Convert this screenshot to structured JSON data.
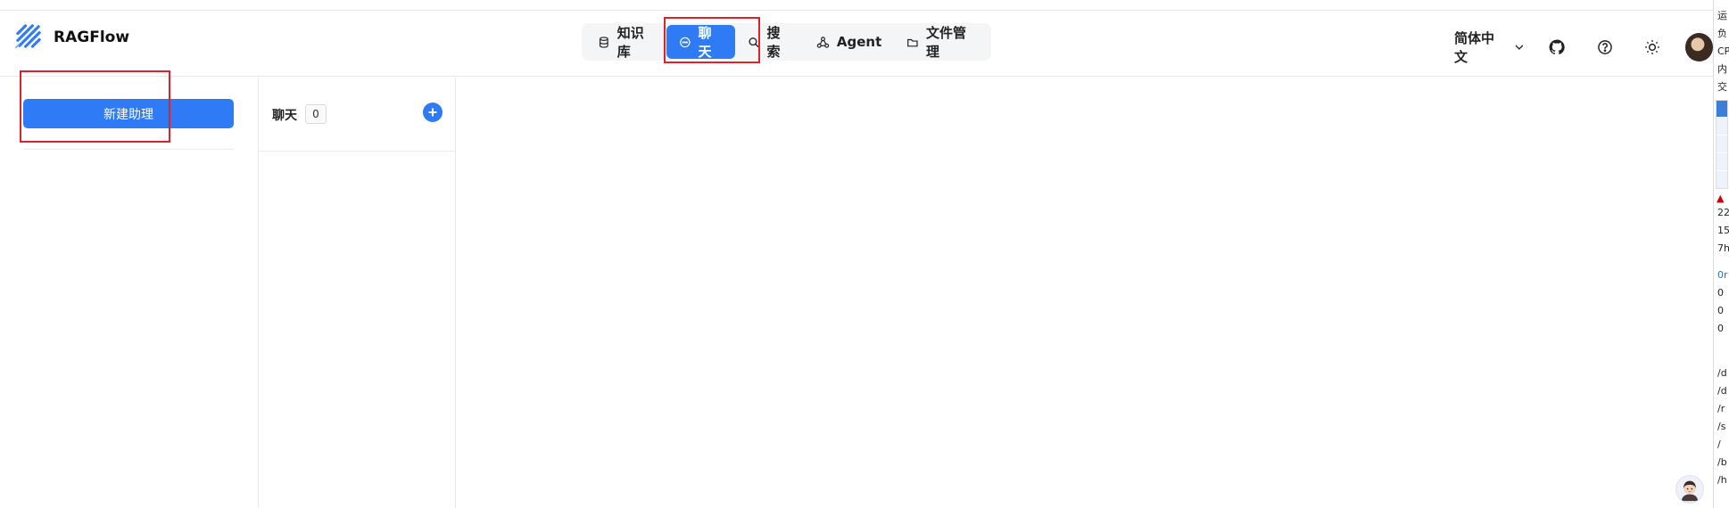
{
  "app": {
    "name": "RAGFlow"
  },
  "nav": {
    "items": [
      {
        "label": "知识库",
        "icon": "database-icon",
        "active": false
      },
      {
        "label": "聊天",
        "icon": "chat-bubble-icon",
        "active": true
      },
      {
        "label": "搜索",
        "icon": "search-icon",
        "active": false
      },
      {
        "label": "Agent",
        "icon": "agent-graph-icon",
        "active": false
      },
      {
        "label": "文件管理",
        "icon": "folder-icon",
        "active": false
      }
    ]
  },
  "header": {
    "language": "简体中文",
    "icons": [
      "github-icon",
      "help-icon",
      "theme-sun-icon",
      "user-avatar"
    ]
  },
  "sidebar": {
    "new_assistant_label": "新建助理"
  },
  "chat_list": {
    "title": "聊天",
    "count": "0"
  },
  "right_edge": {
    "lines_top": [
      "运",
      "负",
      "CP",
      "内",
      "交"
    ],
    "lines_mid": [
      "22",
      "15",
      "7h"
    ],
    "lines_low": [
      "0r",
      "0",
      "0",
      "0"
    ],
    "paths": [
      "/d",
      "/d",
      "/r",
      "/s",
      "/",
      "/b",
      "/h"
    ]
  },
  "colors": {
    "primary": "#2f7bf5",
    "highlight": "#e0202a"
  }
}
